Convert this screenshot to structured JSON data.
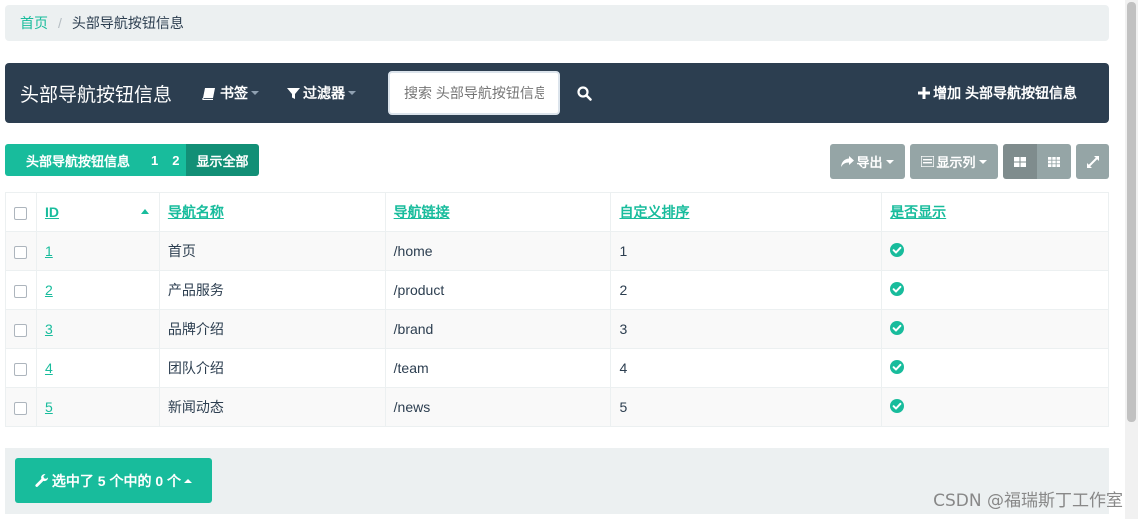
{
  "breadcrumb": {
    "home": "首页",
    "separator": "/",
    "current": "头部导航按钮信息"
  },
  "navbar": {
    "brand": "头部导航按钮信息",
    "bookmark_label": "书签",
    "filter_label": "过滤器",
    "search_placeholder": "搜索 头部导航按钮信息",
    "add_label": "增加 头部导航按钮信息"
  },
  "pills": {
    "title": "头部导航按钮信息",
    "page1": "1",
    "page2": "2",
    "show_all": "显示全部"
  },
  "toolbar": {
    "export_label": "导出",
    "columns_label": "显示列"
  },
  "table": {
    "headers": [
      "ID",
      "导航名称",
      "导航链接",
      "自定义排序",
      "是否显示"
    ],
    "rows": [
      {
        "id": "1",
        "name": "首页",
        "link": "/home",
        "order": "1"
      },
      {
        "id": "2",
        "name": "产品服务",
        "link": "/product",
        "order": "2"
      },
      {
        "id": "3",
        "name": "品牌介绍",
        "link": "/brand",
        "order": "3"
      },
      {
        "id": "4",
        "name": "团队介绍",
        "link": "/team",
        "order": "4"
      },
      {
        "id": "5",
        "name": "新闻动态",
        "link": "/news",
        "order": "5"
      }
    ]
  },
  "footer": {
    "selection_label": "选中了 5 个中的 0 个"
  },
  "watermark": "CSDN @福瑞斯丁工作室",
  "colors": {
    "accent": "#18bc9c",
    "navbar": "#2c3e50",
    "tool_button": "#95a5a6"
  },
  "icons": {
    "bookmark": "book-icon",
    "filter": "filter-icon",
    "search": "search-icon",
    "add": "plus-icon",
    "export": "share-icon",
    "columns": "list-icon",
    "view_card": "grid-large-icon",
    "view_table": "grid-small-icon",
    "fullscreen": "expand-icon",
    "shown": "check-circle-icon",
    "selection": "wrench-icon"
  }
}
